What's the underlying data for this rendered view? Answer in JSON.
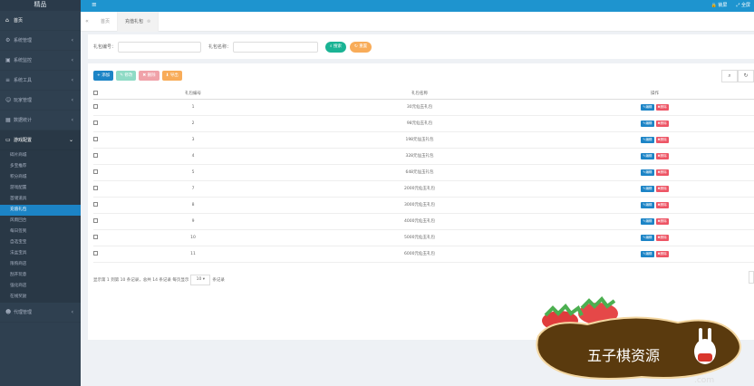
{
  "app": {
    "logo": "精品"
  },
  "topbar": {
    "menu_icon": "hamburger-icon",
    "lock_label": "锁屏",
    "fullscreen_label": "全屏"
  },
  "sidebar": {
    "items": [
      {
        "label": "首页",
        "icon": "home-icon"
      },
      {
        "label": "系统管理",
        "icon": "gear-icon"
      },
      {
        "label": "系统监控",
        "icon": "video-icon"
      },
      {
        "label": "系统工具",
        "icon": "bars-icon"
      },
      {
        "label": "玩家管理",
        "icon": "user-icon"
      },
      {
        "label": "数据统计",
        "icon": "chart-icon"
      },
      {
        "label": "游戏配置",
        "icon": "monitor-icon"
      }
    ],
    "submenu": [
      "碎片商城",
      "多宝推荐",
      "积分商城",
      "游戏配置",
      "首储道具",
      "充值礼包",
      "风雨回合",
      "每日签到",
      "自选宝宝",
      "法盆宝具",
      "限购商店",
      "刮开玩意",
      "强化商店",
      "在线奖励"
    ],
    "bottom_item": {
      "label": "代理管理",
      "icon": "users-icon"
    }
  },
  "tabs": {
    "home": "首页",
    "active": "充值礼包"
  },
  "search": {
    "id_label": "礼包编号：",
    "name_label": "礼包名称：",
    "search_btn": "搜索",
    "reset_btn": "重置"
  },
  "toolbar": {
    "add": "添加",
    "edit": "修改",
    "delete": "删除",
    "export": "导出"
  },
  "table": {
    "headers": [
      "礼包编号",
      "礼包名称",
      "操作"
    ],
    "edit_label": "编辑",
    "delete_label": "删除",
    "rows": [
      {
        "id": "1",
        "name": "30元仙玉礼包"
      },
      {
        "id": "2",
        "name": "98元仙玉礼包"
      },
      {
        "id": "3",
        "name": "198元仙玉礼包"
      },
      {
        "id": "4",
        "name": "328元仙玉礼包"
      },
      {
        "id": "5",
        "name": "648元仙玉礼包"
      },
      {
        "id": "7",
        "name": "2000元仙玉礼包"
      },
      {
        "id": "8",
        "name": "3000元仙玉礼包"
      },
      {
        "id": "9",
        "name": "4000元仙玉礼包"
      },
      {
        "id": "10",
        "name": "5000元仙玉礼包"
      },
      {
        "id": "11",
        "name": "6000元仙玉礼包"
      }
    ]
  },
  "pager": {
    "summary": "显示第 1 到第 10 条记录，总共 14 条记录 每页显示",
    "size": "10",
    "suffix": "条记录"
  },
  "watermark": {
    "text": "五子棋资源",
    "domain": ".com"
  },
  "colors": {
    "sidebar": "#2f4050",
    "topbar": "#1e94cf",
    "accent": "#1c84c6",
    "danger": "#ed5565",
    "success": "#1ab394",
    "warning": "#f8ac59"
  }
}
